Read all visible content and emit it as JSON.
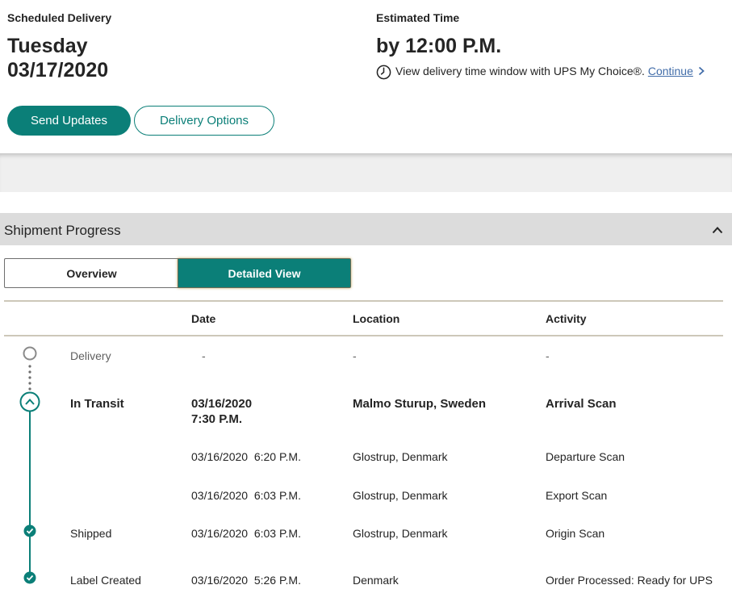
{
  "scheduled": {
    "label": "Scheduled Delivery",
    "day": "Tuesday",
    "date": "03/17/2020"
  },
  "estimated": {
    "label": "Estimated Time",
    "time": "by 12:00 P.M.",
    "note": "View delivery time window with UPS My Choice®.",
    "link": "Continue"
  },
  "buttons": {
    "send_updates": "Send Updates",
    "delivery_options": "Delivery Options"
  },
  "section": {
    "title": "Shipment Progress"
  },
  "view_toggle": {
    "overview": "Overview",
    "detailed": "Detailed View",
    "selected": "Detailed View"
  },
  "table": {
    "headers": {
      "date": "Date",
      "location": "Location",
      "activity": "Activity"
    },
    "rows": [
      {
        "status": "Delivery",
        "date": "-",
        "location": "-",
        "activity": "-"
      },
      {
        "status": "In Transit",
        "date_line1": "03/16/2020",
        "date_line2": "7:30 P.M.",
        "location": "Malmo Sturup, Sweden",
        "activity": "Arrival Scan"
      },
      {
        "status": "",
        "date": "03/16/2020  6:20 P.M.",
        "location": "Glostrup, Denmark",
        "activity": "Departure Scan"
      },
      {
        "status": "",
        "date": "03/16/2020  6:03 P.M.",
        "location": "Glostrup, Denmark",
        "activity": "Export Scan"
      },
      {
        "status": "Shipped",
        "date": "03/16/2020  6:03 P.M.",
        "location": "Glostrup, Denmark",
        "activity": "Origin Scan"
      },
      {
        "status": "Label Created",
        "date": "03/16/2020  5:26 P.M.",
        "location": "Denmark",
        "activity": "Order Processed: Ready for UPS"
      }
    ]
  },
  "colors": {
    "accent": "#0b7f78",
    "link": "#426da9",
    "pending_icon": "#8a8a8a"
  },
  "icons": [
    "clock-icon",
    "chevron-right-icon",
    "chevron-up-icon",
    "pending-circle-icon",
    "current-step-icon",
    "check-circle-icon"
  ]
}
